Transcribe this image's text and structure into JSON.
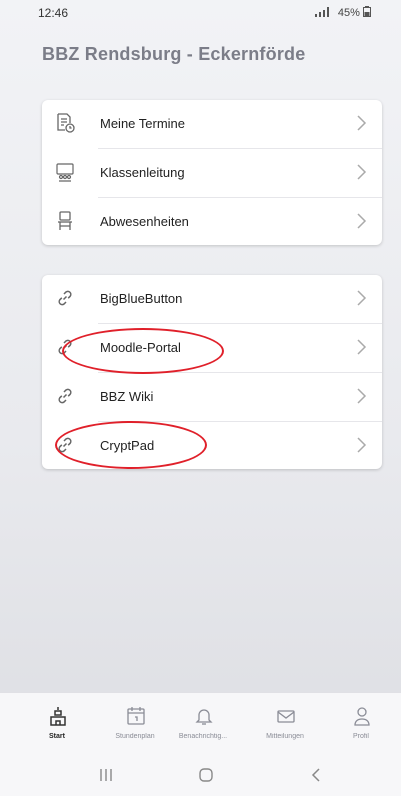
{
  "status": {
    "time": "12:46",
    "indicators": "45%"
  },
  "page": {
    "title": "BBZ Rendsburg - Eckernförde"
  },
  "card1": {
    "items": [
      {
        "label": "Meine Termine",
        "icon": "calendar-list-icon"
      },
      {
        "label": "Klassenleitung",
        "icon": "class-group-icon"
      },
      {
        "label": "Abwesenheiten",
        "icon": "chair-icon"
      }
    ]
  },
  "card2": {
    "items": [
      {
        "label": "BigBlueButton",
        "icon": "link-icon"
      },
      {
        "label": "Moodle-Portal",
        "icon": "link-icon"
      },
      {
        "label": "BBZ Wiki",
        "icon": "link-icon"
      },
      {
        "label": "CryptPad",
        "icon": "link-icon"
      }
    ]
  },
  "tabs": [
    {
      "label": "Start",
      "icon": "home-icon",
      "active": true
    },
    {
      "label": "Stundenplan",
      "icon": "calendar-icon",
      "active": false
    },
    {
      "label": "Benachrichtig...",
      "icon": "bell-icon",
      "active": false
    },
    {
      "label": "Mitteilungen",
      "icon": "mail-icon",
      "active": false
    },
    {
      "label": "Profil",
      "icon": "person-icon",
      "active": false
    }
  ],
  "colors": {
    "annotation": "#e0202a",
    "title": "#7b7d88"
  }
}
